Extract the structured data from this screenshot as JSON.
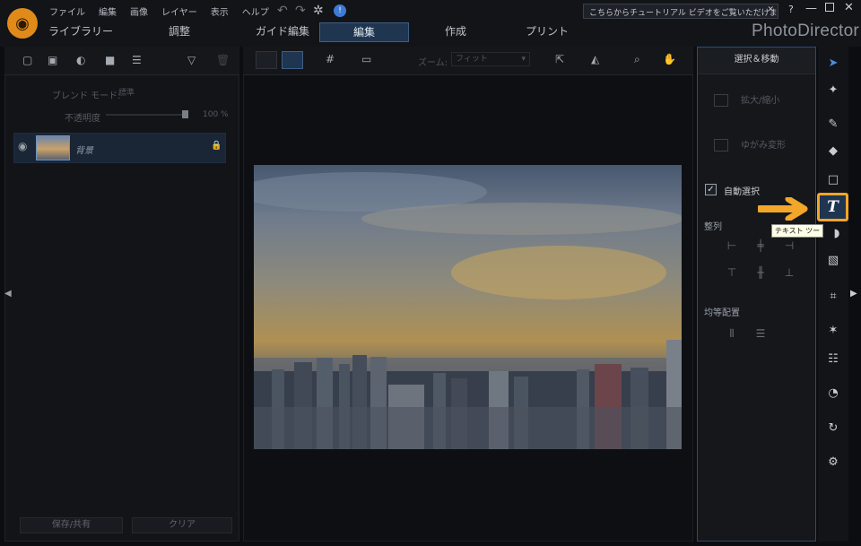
{
  "menu": [
    "ファイル",
    "編集",
    "画像",
    "レイヤー",
    "表示",
    "ヘルプ"
  ],
  "tutorial_banner": "こちらからチュートリアル ビデオをご覧いただけます。",
  "window_controls": {
    "help": "?",
    "minimize": "—",
    "close": "✕"
  },
  "mode_tabs": [
    {
      "label": "ライブラリー",
      "active": false
    },
    {
      "label": "調整",
      "active": false
    },
    {
      "label": "ガイド編集",
      "active": false
    },
    {
      "label": "編集",
      "active": true
    },
    {
      "label": "作成",
      "active": false
    },
    {
      "label": "プリント",
      "active": false
    }
  ],
  "app_name": "PhotoDirector",
  "left_panel": {
    "blend_mode_label": "ブレンド モード:",
    "blend_mode_value": "標準",
    "opacity_label": "不透明度",
    "opacity_value": "100 %",
    "opacity_fraction": 1.0,
    "layer_name": "背景",
    "save_share": "保存/共有",
    "clear": "クリア"
  },
  "center": {
    "zoom_label": "ズーム:",
    "zoom_value": "フィット"
  },
  "right_panel": {
    "header": "選択＆移動",
    "scale": "拡大/縮小",
    "warp": "ゆがみ変形",
    "auto_select": "自動選択",
    "auto_select_checked": true,
    "align": "整列",
    "distribute": "均等配置"
  },
  "tool_tooltip": "テキスト ツール",
  "text_tool_glyph": "T",
  "colors": {
    "accent": "#3d5f86",
    "highlight": "#f2a62a",
    "background": "#0c0d10"
  }
}
